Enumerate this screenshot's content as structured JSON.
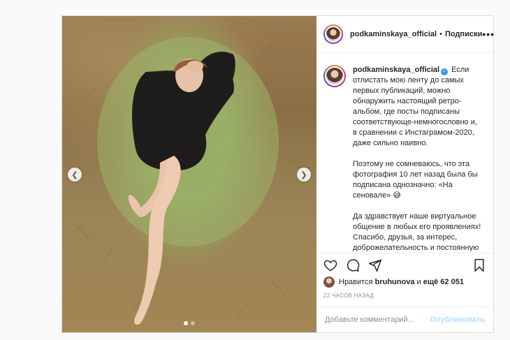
{
  "post": {
    "username": "podkaminskaya_official",
    "separator": "•",
    "follow_label": "Подписки",
    "more_label": "•••",
    "caption": {
      "username": "podkaminskaya_official",
      "paragraphs": [
        "Если отлистать мою ленту до самых первых публикаций, можно обнаружить настоящий ретро-альбом, где посты подписаны соответствующе-немногословно и, в сравнении с Инстаграмом-2020, даже сильно наивно.",
        "Поэтому не сомневаюсь, что эта фотография 10 лет назад была бы подписана однозначно: «На сеновале» 😅",
        "Да здравствует наше виртуальное общение в любых его проявлениях! Спасибо, друзья, за интерес, доброжелательность и постоянную обратную связь! И день, и ночь! И день, и ночь! 💚💚💚💚❤️"
      ]
    },
    "likes": {
      "prefix": "Нравится ",
      "user": "bruhunova",
      "middle": " и ",
      "others": "ещё 62 051"
    },
    "timestamp": "22 ЧАСОВ НАЗАД",
    "comment_placeholder": "Добавьте комментарий...",
    "post_button": "Опубликовать",
    "carousel": {
      "total": 2,
      "active": 1
    }
  },
  "icons": {
    "prev": "chevron-left-icon",
    "next": "chevron-right-icon",
    "like": "heart-icon",
    "comment": "comment-icon",
    "share": "paper-plane-icon",
    "save": "bookmark-icon"
  },
  "colors": {
    "verified": "#3897f0",
    "post_button_disabled": "#b3dbff",
    "muted_text": "#8e8e8e"
  }
}
